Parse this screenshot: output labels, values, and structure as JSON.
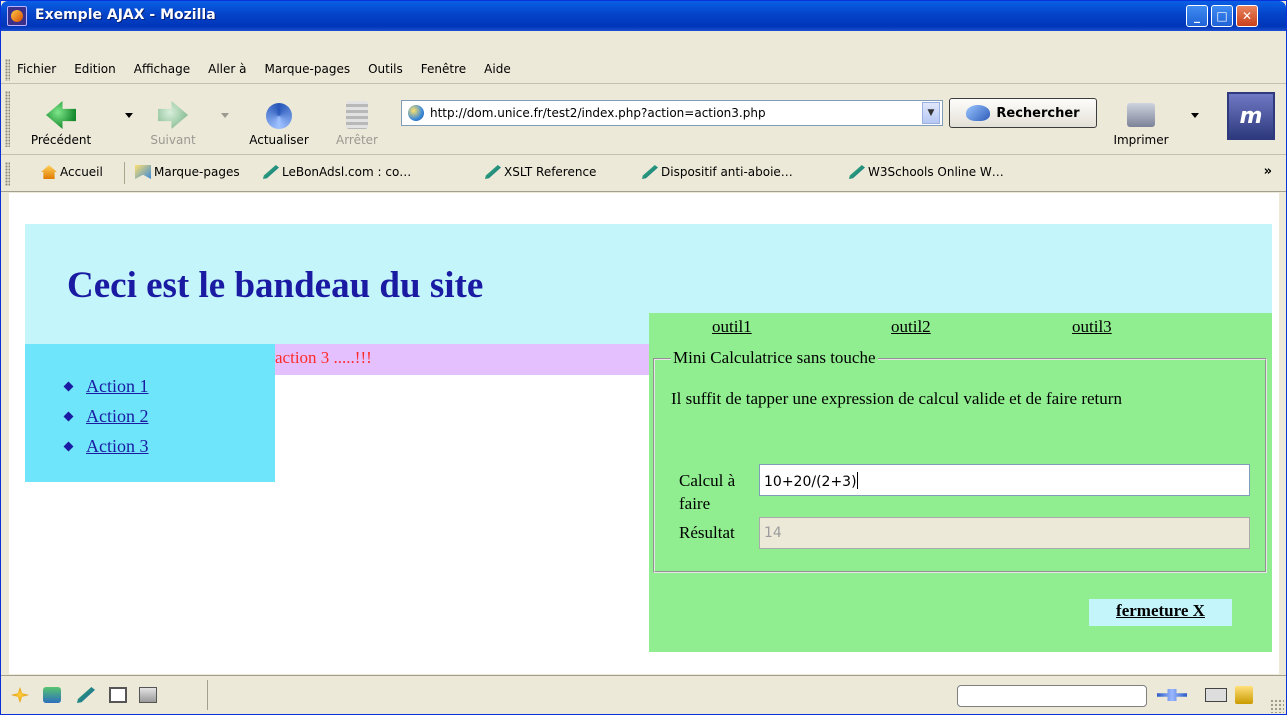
{
  "window": {
    "title": "Exemple AJAX - Mozilla",
    "controls": {
      "minimize": "_",
      "maximize": "□",
      "close": "✕"
    }
  },
  "menubar": {
    "items": [
      "Fichier",
      "Edition",
      "Affichage",
      "Aller à",
      "Marque-pages",
      "Outils",
      "Fenêtre",
      "Aide"
    ]
  },
  "navbar": {
    "back": {
      "label": "Précédent",
      "icon": "back-arrow-icon"
    },
    "forward": {
      "label": "Suivant",
      "icon": "forward-arrow-icon"
    },
    "reload": {
      "label": "Actualiser",
      "icon": "reload-icon"
    },
    "stop": {
      "label": "Arrêter",
      "icon": "stop-icon"
    },
    "url": "http://dom.unice.fr/test2/index.php?action=action3.php",
    "search_label": "Rechercher",
    "print_label": "Imprimer",
    "throbber_text": "m"
  },
  "bookmarks": {
    "home": "Accueil",
    "bookmarks": "Marque-pages",
    "items": [
      "LeBonAdsl.com : co…",
      "XSLT Reference",
      "Dispositif anti-aboie…",
      "W3Schools Online W…"
    ],
    "more": "»"
  },
  "page": {
    "banner_title": "Ceci est le bandeau du site",
    "nav_links": [
      "Action 1",
      "Action 2",
      "Action 3"
    ],
    "action_message": "action 3 .....!!!",
    "tool_links": [
      "outil1",
      "outil2",
      "outil3"
    ],
    "calculator": {
      "legend": "Mini Calculatrice sans touche",
      "description": "Il suffit de tapper une expression de calcul valide et de faire return",
      "calc_label": "Calcul à faire",
      "calc_value": "10+20/(2+3)",
      "result_label": "Résultat",
      "result_value": "14"
    },
    "close_label": "fermeture X"
  },
  "colors": {
    "banner_bg": "#c3f5fb",
    "nav_bg": "#6fe5fb",
    "message_bg": "#e5c0ff",
    "message_text": "#ff2b2b",
    "tool_panel_bg": "#90ee90",
    "link": "#1a1aa2"
  }
}
